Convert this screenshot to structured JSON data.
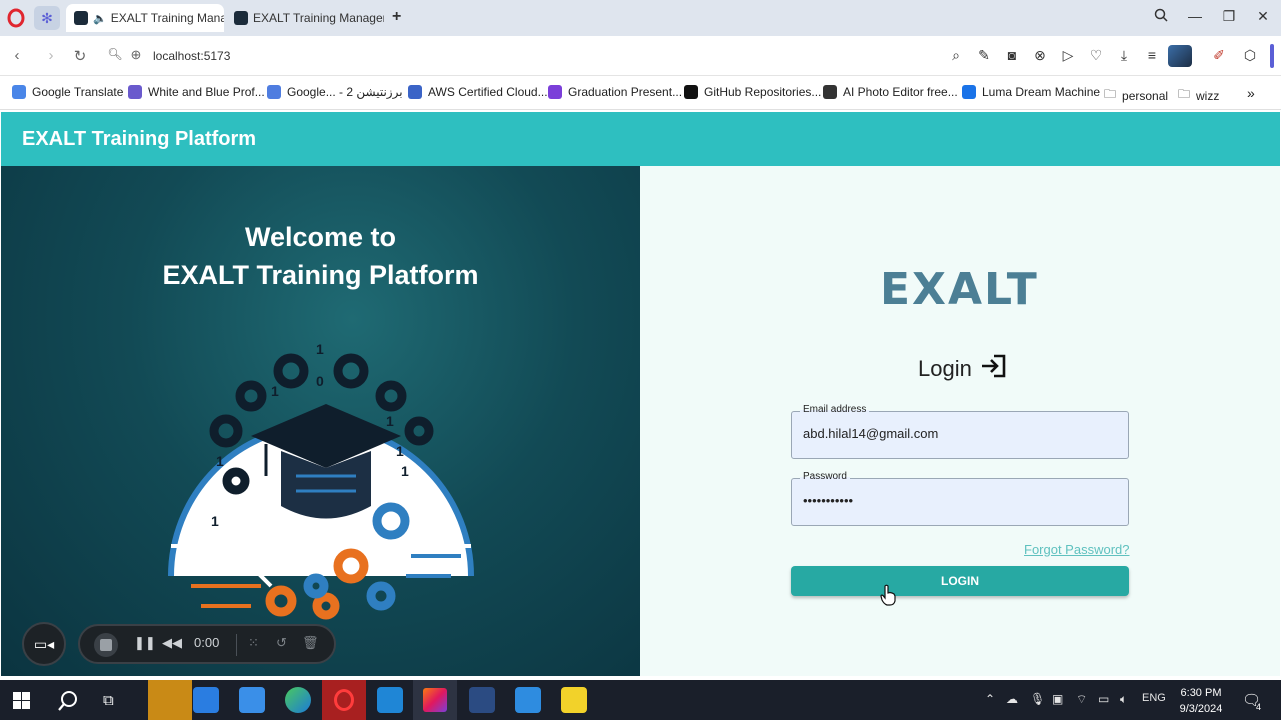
{
  "browser": {
    "tabs": [
      {
        "title": "EXALT Training Manag",
        "active": true
      },
      {
        "title": "EXALT Training Manageme",
        "active": false
      }
    ],
    "address": "localhost:5173",
    "bookmarks": [
      {
        "label": "Google Translate",
        "color": "#4a86e8"
      },
      {
        "label": "White and Blue Prof...",
        "color": "#6a5acd"
      },
      {
        "label": "Google... - 2 برزنتيشن",
        "color": "#4f7de0"
      },
      {
        "label": "AWS Certified Cloud...",
        "color": "#3b64c7"
      },
      {
        "label": "Graduation Present...",
        "color": "#7b3fd9"
      },
      {
        "label": "GitHub Repositories...",
        "color": "#111111"
      },
      {
        "label": "AI Photo Editor free...",
        "color": "#333333"
      },
      {
        "label": "Luma Dream Machine",
        "color": "#1a73e8"
      },
      {
        "label": "personal",
        "color": "#555555"
      },
      {
        "label": "wizz",
        "color": "#555555"
      }
    ]
  },
  "app": {
    "header_title": "EXALT Training Platform",
    "welcome_line1": "Welcome to",
    "welcome_line2": "EXALT Training Platform",
    "logo_text": "EXALT",
    "login": {
      "heading": "Login",
      "email_label": "Email address",
      "email_value": "abd.hilal14@gmail.com",
      "password_label": "Password",
      "password_value": "•••••••••••",
      "forgot": "Forgot Password?",
      "button": "LOGIN"
    },
    "colors": {
      "accent": "#2ebfc0",
      "button": "#27a9a3",
      "panel_bg": "#f1fbf9",
      "left_bg": "#124a55"
    }
  },
  "recorder": {
    "time": "0:00"
  },
  "taskbar": {
    "lang": "ENG",
    "time": "6:30 PM",
    "date": "9/3/2024",
    "notifications": "4"
  }
}
